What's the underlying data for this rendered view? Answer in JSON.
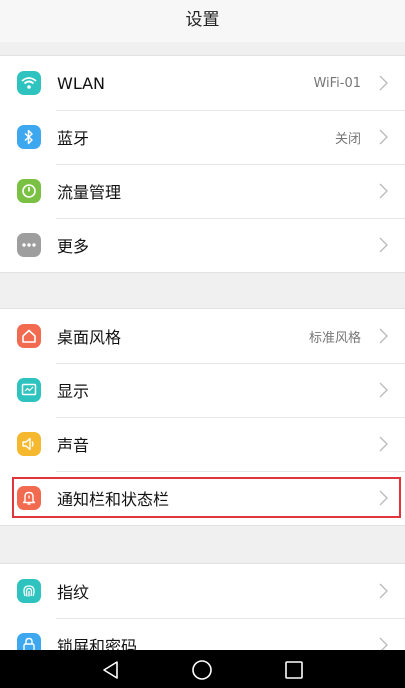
{
  "header": {
    "title": "设置"
  },
  "groups": [
    {
      "items": [
        {
          "label": "WLAN",
          "value": "WiFi-01",
          "icon": "wifi-icon",
          "color": "#2ec3bf"
        },
        {
          "label": "蓝牙",
          "value": "关闭",
          "icon": "bluetooth-icon",
          "color": "#3da7f0"
        },
        {
          "label": "流量管理",
          "value": "",
          "icon": "data-usage-icon",
          "color": "#7ac143"
        },
        {
          "label": "更多",
          "value": "",
          "icon": "more-icon",
          "color": "#9e9e9e"
        }
      ]
    },
    {
      "items": [
        {
          "label": "桌面风格",
          "value": "标准风格",
          "icon": "home-style-icon",
          "color": "#f26a4f"
        },
        {
          "label": "显示",
          "value": "",
          "icon": "display-icon",
          "color": "#2ec3bf"
        },
        {
          "label": "声音",
          "value": "",
          "icon": "sound-icon",
          "color": "#f5b82e"
        },
        {
          "label": "通知栏和状态栏",
          "value": "",
          "icon": "notification-bell-icon",
          "color": "#f26a4f",
          "highlighted": true
        }
      ]
    },
    {
      "items": [
        {
          "label": "指纹",
          "value": "",
          "icon": "fingerprint-icon",
          "color": "#2ec3bf"
        },
        {
          "label": "锁屏和密码",
          "value": "",
          "icon": "lock-icon",
          "color": "#3da7f0"
        }
      ]
    }
  ],
  "navbar": {
    "buttons": [
      "back-icon",
      "home-icon",
      "recents-icon"
    ]
  }
}
